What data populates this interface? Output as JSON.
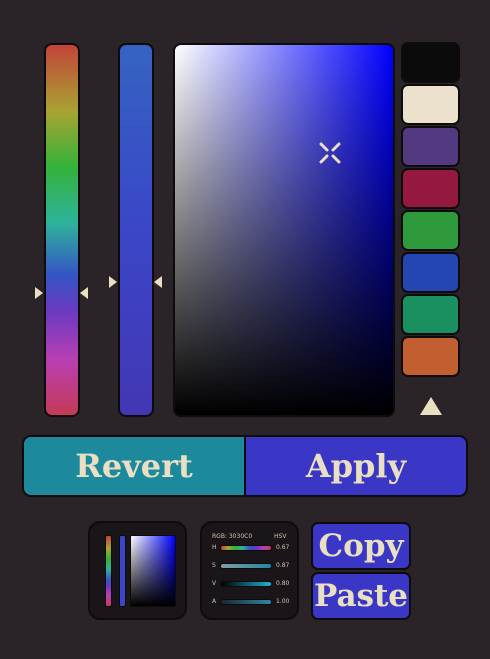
{
  "buttons": {
    "revert": "Revert",
    "apply": "Apply",
    "copy": "Copy",
    "paste": "Paste"
  },
  "current_color": "#3A37C6",
  "swatches": [
    "#0b0b0b",
    "#ece1cc",
    "#53397f",
    "#95183e",
    "#2f9a3c",
    "#2446b3",
    "#1a9060",
    "#c15f30"
  ],
  "accent_colors": {
    "revert_bg": "#1c8a9c",
    "apply_bg": "#3a37c6",
    "background": "#2a2428",
    "marker": "#eadfc2"
  },
  "icons": {
    "sv_cursor": "crosshair-x-icon",
    "add_swatch": "triangle-up-icon",
    "slider_marker": "triangle-pointer-icon"
  },
  "mini_sliders": {
    "header_left": "RGB: 3030C0",
    "header_right": "HSV",
    "rows": [
      {
        "label": "H",
        "value": "0.67"
      },
      {
        "label": "S",
        "value": "0.87"
      },
      {
        "label": "V",
        "value": "0.80"
      },
      {
        "label": "A",
        "value": "1.00"
      }
    ]
  }
}
